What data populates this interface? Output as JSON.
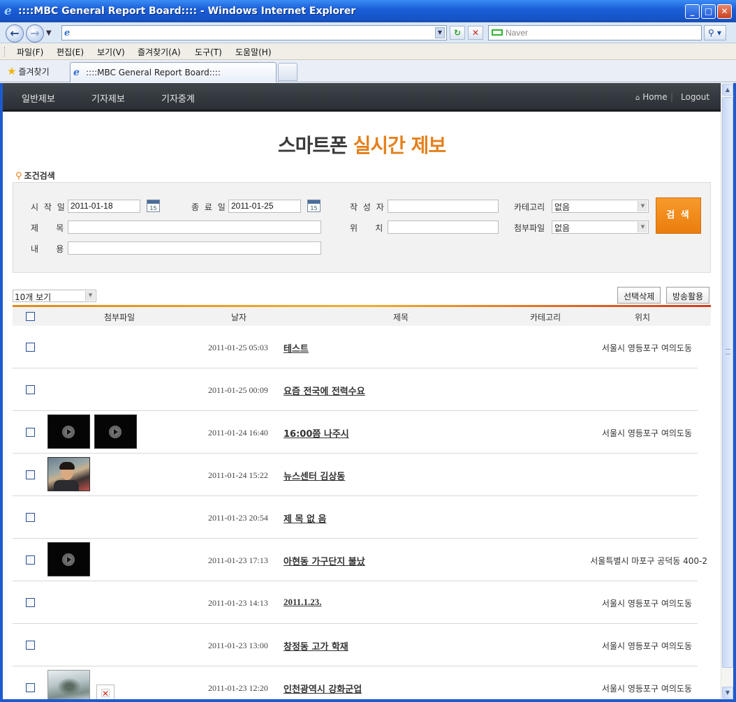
{
  "window": {
    "title": "::::MBC General Report Board:::: - Windows Internet Explorer",
    "minimize": "_",
    "maximize": "□",
    "close": "✕"
  },
  "addressbar": {
    "url": "",
    "search_placeholder": "Naver"
  },
  "menu": [
    "파일(F)",
    "편집(E)",
    "보기(V)",
    "즐겨찾기(A)",
    "도구(T)",
    "도움말(H)"
  ],
  "favorites_label": "즐겨찾기",
  "tab_title": "::::MBC General Report Board::::",
  "sitenav": {
    "links": [
      "일반제보",
      "기자제보",
      "기자중계"
    ],
    "home": "Home",
    "logout": "Logout"
  },
  "page_title": {
    "main": "스마트폰 ",
    "accent": "실시간 제보"
  },
  "search": {
    "section_label": "조건검색",
    "start_label": "시 작 일",
    "start_value": "2011-01-18",
    "end_label": "종 료 일",
    "end_value": "2011-01-25",
    "author_label": "작 성 자",
    "author_value": "",
    "category_label": "카테고리",
    "category_value": "없음",
    "subject_label": "제    목",
    "subject_value": "",
    "location_label": "위    치",
    "location_value": "",
    "attach_label": "첨부파일",
    "attach_value": "없음",
    "content_label": "내    용",
    "content_value": "",
    "calendar_day": "15",
    "button": "검 색"
  },
  "list": {
    "page_size": "10개 보기",
    "delete_button": "선택삭제",
    "broadcast_button": "방송활용",
    "headers": {
      "attach": "첨부파일",
      "date": "날자",
      "title": "제목",
      "category": "카테고리",
      "location": "위치"
    },
    "rows": [
      {
        "date": "2011-01-25 05:03",
        "title": "테스트",
        "location": "서울시 영등포구 여의도동",
        "attachments": []
      },
      {
        "date": "2011-01-25 00:09",
        "title": "요즘 전국에 전력수요",
        "location": "",
        "attachments": []
      },
      {
        "date": "2011-01-24 16:40",
        "title": "16:00쯤 나주시",
        "location": "서울시 영등포구 여의도동",
        "attachments": [
          "video",
          "video"
        ]
      },
      {
        "date": "2011-01-24 15:22",
        "title": "뉴스센터 김상동",
        "location": "",
        "attachments": [
          "photo"
        ]
      },
      {
        "date": "2011-01-23 20:54",
        "title": "제 목 없 음",
        "location": "",
        "attachments": []
      },
      {
        "date": "2011-01-23 17:13",
        "title": "아현동 가구단지 불났",
        "location": "서울특별시 마포구 공덕동 400-2",
        "attachments": [
          "video"
        ]
      },
      {
        "date": "2011-01-23 14:13",
        "title": "2011.1.23.",
        "location": "서울시 영등포구 여의도동",
        "attachments": []
      },
      {
        "date": "2011-01-23 13:00",
        "title": "창정동 고가 학재",
        "location": "서울시 영등포구 여의도동",
        "attachments": []
      },
      {
        "date": "2011-01-23 12:20",
        "title": "인천광역시 강화군업",
        "location": "서울시 영등포구 여의도동",
        "attachments": [
          "photo",
          "broken"
        ]
      }
    ]
  }
}
